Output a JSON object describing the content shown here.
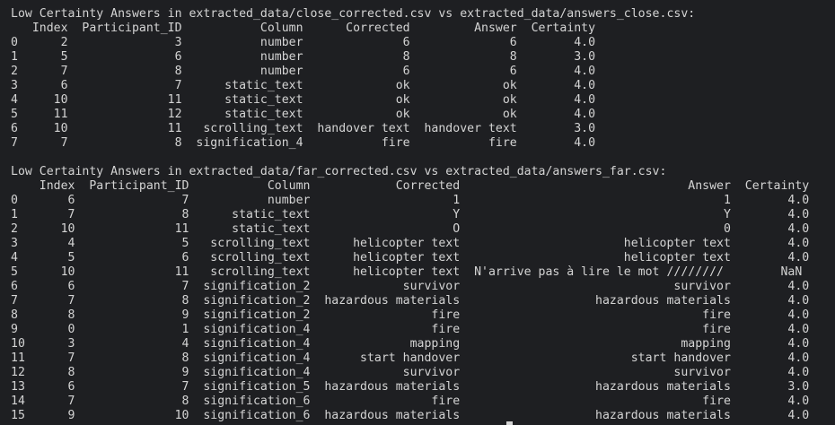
{
  "close_section": {
    "title": "Low Certainty Answers in extracted_data/close_corrected.csv vs extracted_data/answers_close.csv:",
    "header": "   Index  Participant_ID           Column      Corrected         Answer  Certainty",
    "rows": [
      "0      2               3           number              6              6        4.0",
      "1      5               6           number              8              8        3.0",
      "2      7               8           number              6              6        4.0",
      "3      6               7      static_text             ok             ok        4.0",
      "4     10              11      static_text             ok             ok        4.0",
      "5     11              12      static_text             ok             ok        4.0",
      "6     10              11   scrolling_text  handover text  handover text        3.0",
      "7      7               8  signification_4           fire           fire        4.0"
    ]
  },
  "far_section": {
    "title": "Low Certainty Answers in extracted_data/far_corrected.csv vs extracted_data/answers_far.csv:",
    "header": "    Index  Participant_ID           Column            Corrected                                Answer  Certainty",
    "rows": [
      "0       6               7           number                    1                                     1        4.0",
      "1       7               8      static_text                    Y                                     Y        4.0",
      "2      10              11      static_text                    O                                     0        4.0",
      "3       4               5   scrolling_text      helicopter text                       helicopter text        4.0",
      "4       5               6   scrolling_text      helicopter text                       helicopter text        4.0",
      "5      10              11   scrolling_text      helicopter text  N'arrive pas à lire le mot ////////        NaN",
      "6       6               7  signification_2             survivor                              survivor        4.0",
      "7       7               8  signification_2  hazardous materials                   hazardous materials        4.0",
      "8       8               9  signification_2                 fire                                  fire        4.0",
      "9       0               1  signification_4                 fire                                  fire        4.0",
      "10      3               4  signification_4              mapping                               mapping        4.0",
      "11      7               8  signification_4       start handover                        start handover        4.0",
      "12      8               9  signification_4             survivor                              survivor        4.0",
      "13      6               7  signification_5  hazardous materials                   hazardous materials        3.0",
      "14      7               8  signification_6                 fire                                  fire        4.0",
      "15      9              10  signification_6  hazardous materials                   hazardous materials        4.0"
    ]
  },
  "colors": {
    "background": "#1e1f22",
    "foreground": "#d4d4d4"
  }
}
